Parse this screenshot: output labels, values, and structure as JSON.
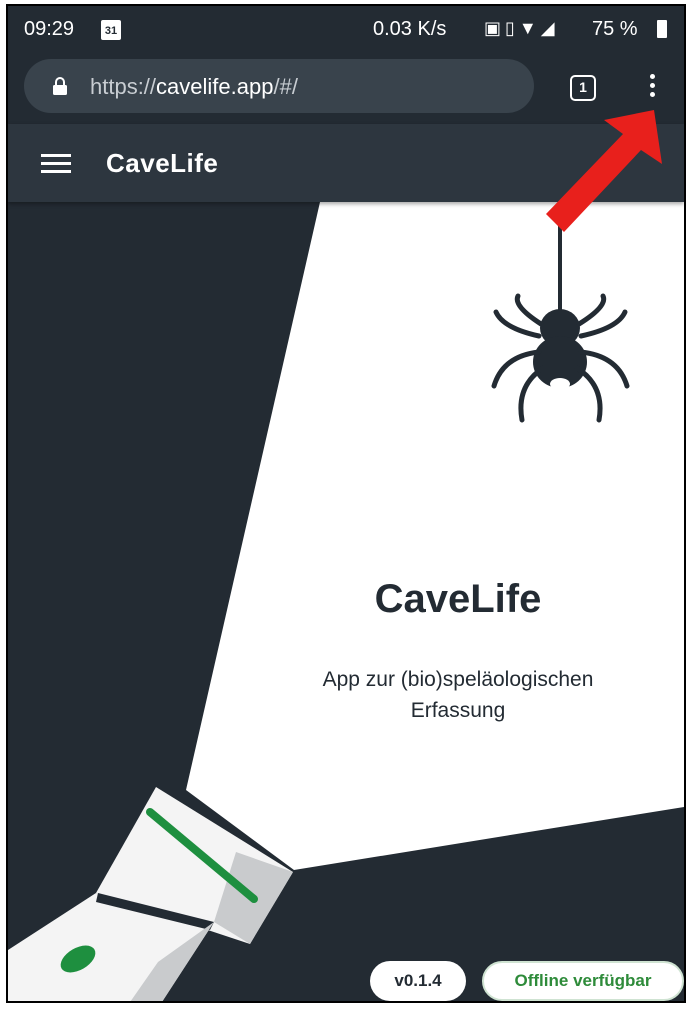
{
  "status_bar": {
    "time": "09:29",
    "calendar_day": "31",
    "network_speed": "0.03 K/s",
    "battery": "75 %"
  },
  "browser": {
    "url_prefix": "https://",
    "url_host": "cavelife.app",
    "url_path": "/#/",
    "tab_count": "1"
  },
  "app_bar": {
    "title": "CaveLife"
  },
  "hero": {
    "title": "CaveLife",
    "subtitle_line1": "App zur (bio)speläologischen",
    "subtitle_line2": "Erfassung"
  },
  "chips": {
    "version": "v0.1.4",
    "offline": "Offline verfügbar"
  },
  "colors": {
    "background": "#232b33",
    "app_bar": "#2d363f",
    "accent_green": "#1e8f3f",
    "annotation_arrow": "#e8201c"
  },
  "icons": [
    "calendar-icon",
    "nfc-icon",
    "vibrate-icon",
    "wifi-icon",
    "signal-icon",
    "battery-icon",
    "lock-icon",
    "tab-switcher-icon",
    "menu-dots-icon",
    "hamburger-icon",
    "spider-icon",
    "flashlight-icon"
  ]
}
